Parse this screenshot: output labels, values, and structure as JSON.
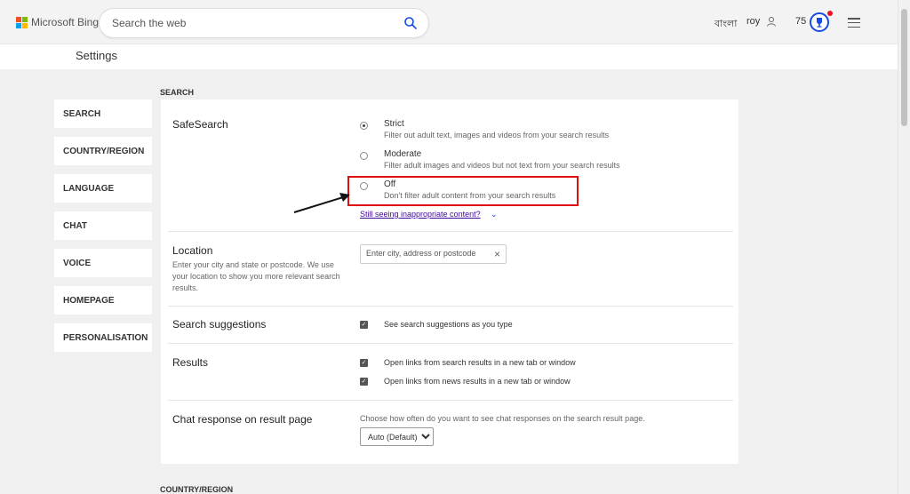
{
  "header": {
    "logo_text": "Microsoft Bing",
    "search_placeholder": "Search the web",
    "language": "বাংলা",
    "user_name": "roy",
    "points": "75"
  },
  "page": {
    "title": "Settings"
  },
  "sidebar": {
    "items": [
      {
        "label": "SEARCH"
      },
      {
        "label": "COUNTRY/REGION"
      },
      {
        "label": "LANGUAGE"
      },
      {
        "label": "CHAT"
      },
      {
        "label": "VOICE"
      },
      {
        "label": "HOMEPAGE"
      },
      {
        "label": "PERSONALISATION"
      }
    ]
  },
  "sections": {
    "search_heading": "SEARCH",
    "next_heading": "COUNTRY/REGION"
  },
  "safesearch": {
    "title": "SafeSearch",
    "options": [
      {
        "label": "Strict",
        "desc": "Filter out adult text, images and videos from your search results",
        "selected": true
      },
      {
        "label": "Moderate",
        "desc": "Filter adult images and videos but not text from your search results",
        "selected": false
      },
      {
        "label": "Off",
        "desc": "Don't filter adult content from your search results",
        "selected": false
      }
    ],
    "link": "Still seeing inappropriate content?"
  },
  "location": {
    "title": "Location",
    "desc": "Enter your city and state or postcode. We use your location to show you more relevant search results.",
    "placeholder": "Enter city, address or postcode"
  },
  "suggestions": {
    "title": "Search suggestions",
    "checkbox_label": "See search suggestions as you type"
  },
  "results": {
    "title": "Results",
    "checkbox_1": "Open links from search results in a new tab or window",
    "checkbox_2": "Open links from news results in a new tab or window"
  },
  "chat_response": {
    "title": "Chat response on result page",
    "desc": "Choose how often do you want to see chat responses on the search result page.",
    "selected": "Auto (Default)"
  },
  "colors": {
    "highlight": "#e01010",
    "link": "#4007a2",
    "accent": "#174ae4"
  }
}
